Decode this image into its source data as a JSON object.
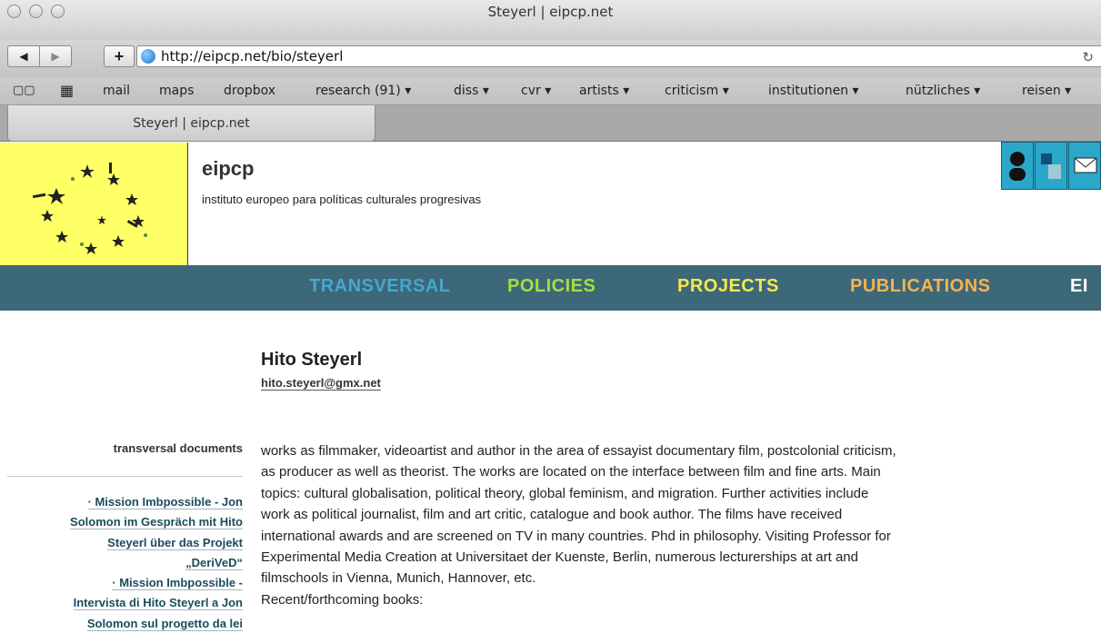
{
  "window": {
    "title": "Steyerl | eipcp.net"
  },
  "toolbar": {
    "back": "◀",
    "forward": "▶",
    "add": "+",
    "url": "http://eipcp.net/bio/steyerl",
    "reload": "↻"
  },
  "bookmarks": {
    "book_icon": "▢▢",
    "grid_icon": "▦",
    "items": [
      "mail",
      "maps",
      "dropbox",
      "research (91) ▾",
      "diss ▾",
      "cvr ▾",
      "artists ▾",
      "criticism ▾",
      "institutionen ▾",
      "nützliches ▾",
      "reisen ▾"
    ]
  },
  "tab": {
    "label": "Steyerl | eipcp.net"
  },
  "site": {
    "name": "eipcp",
    "tagline": "instituto europeo para políticas culturales progresivas"
  },
  "nav": [
    {
      "label": "TRANSVERSAL",
      "color": "#44a8cf"
    },
    {
      "label": "POLICIES",
      "color": "#a6de3f"
    },
    {
      "label": "PROJECTS",
      "color": "#f4e84a"
    },
    {
      "label": "PUBLICATIONS",
      "color": "#f6b34f"
    },
    {
      "label": "EI",
      "color": "#ffffff"
    }
  ],
  "person": {
    "name": "Hito Steyerl",
    "email": "hito.steyerl@gmx.net"
  },
  "sidebar": {
    "heading": "transversal documents",
    "lines": [
      "· Mission Imbpossible - Jon",
      "Solomon im Gespräch mit Hito",
      "Steyerl über das Projekt",
      "„DeriVeD“",
      "· Mission Imbpossible -",
      "Intervista di Hito Steyerl a Jon",
      "Solomon sul progetto da lei"
    ]
  },
  "bio": {
    "lines": [
      "works as filmmaker, videoartist and author in the area of essayist documentary film, postcolonial criticism,",
      "as producer as well as theorist. The works are located on the interface between film and fine arts. Main",
      "topics: cultural globalisation, political theory, global feminism, and migration. Further activities include",
      "work as political journalist, film and art critic, catalogue and book author. The films have received",
      "international awards and are screened on TV in many countries. Phd in philosophy. Visiting Professor for",
      "Experimental Media Creation at Universitaet der Kuenste, Berlin, numerous lecturerships at art and",
      "filmschools in Vienna, Munich, Hannover, etc.",
      "Recent/forthcoming books:"
    ]
  }
}
